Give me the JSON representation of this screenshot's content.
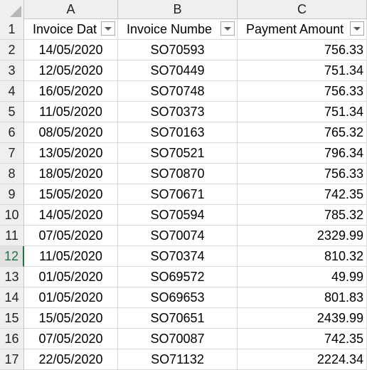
{
  "columns": [
    "A",
    "B",
    "C"
  ],
  "headers": {
    "invoice_date": "Invoice Dat",
    "invoice_number": "Invoice Numbe",
    "payment_amount": "Payment Amount"
  },
  "selected_row": "12",
  "rows": [
    {
      "num": "1"
    },
    {
      "num": "2",
      "date": "14/05/2020",
      "invoice": "SO70593",
      "amount": "756.33"
    },
    {
      "num": "3",
      "date": "12/05/2020",
      "invoice": "SO70449",
      "amount": "751.34"
    },
    {
      "num": "4",
      "date": "16/05/2020",
      "invoice": "SO70748",
      "amount": "756.33"
    },
    {
      "num": "5",
      "date": "11/05/2020",
      "invoice": "SO70373",
      "amount": "751.34"
    },
    {
      "num": "6",
      "date": "08/05/2020",
      "invoice": "SO70163",
      "amount": "765.32"
    },
    {
      "num": "7",
      "date": "13/05/2020",
      "invoice": "SO70521",
      "amount": "796.34"
    },
    {
      "num": "8",
      "date": "18/05/2020",
      "invoice": "SO70870",
      "amount": "756.33"
    },
    {
      "num": "9",
      "date": "15/05/2020",
      "invoice": "SO70671",
      "amount": "742.35"
    },
    {
      "num": "10",
      "date": "14/05/2020",
      "invoice": "SO70594",
      "amount": "785.32"
    },
    {
      "num": "11",
      "date": "07/05/2020",
      "invoice": "SO70074",
      "amount": "2329.99"
    },
    {
      "num": "12",
      "date": "11/05/2020",
      "invoice": "SO70374",
      "amount": "810.32"
    },
    {
      "num": "13",
      "date": "01/05/2020",
      "invoice": "SO69572",
      "amount": "49.99"
    },
    {
      "num": "14",
      "date": "01/05/2020",
      "invoice": "SO69653",
      "amount": "801.83"
    },
    {
      "num": "15",
      "date": "15/05/2020",
      "invoice": "SO70651",
      "amount": "2439.99"
    },
    {
      "num": "16",
      "date": "07/05/2020",
      "invoice": "SO70087",
      "amount": "742.35"
    },
    {
      "num": "17",
      "date": "22/05/2020",
      "invoice": "SO71132",
      "amount": "2224.34"
    }
  ],
  "colors": {
    "selected_row_header": "#217346",
    "header_background": "#efefef",
    "gridline": "#d9d9d9"
  }
}
